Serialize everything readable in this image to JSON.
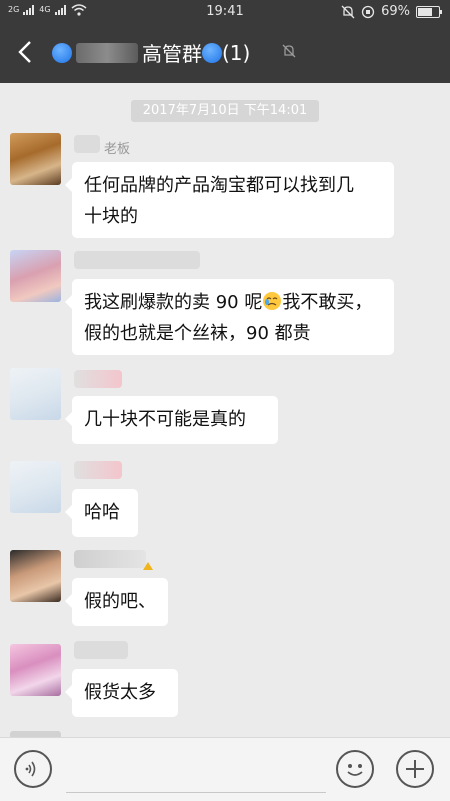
{
  "status_bar": {
    "signal_1": "2G",
    "signal_2": "4G",
    "time": "19:41",
    "battery": "69%",
    "battery_fraction": 0.69
  },
  "header": {
    "title": "高管群",
    "count": "(1)"
  },
  "chat": {
    "timestamp": "2017年7月10日 下午14:01",
    "messages": [
      {
        "sender": "老板",
        "lines": [
          "任何品牌的产品淘宝都可以找到几",
          "十块的"
        ]
      },
      {
        "sender": "",
        "line1_before": "我这刷爆款的卖 90 呢",
        "line1_after": "我不敢买，",
        "line2": "假的也就是个丝袜，90 都贵"
      },
      {
        "sender": "",
        "text": "几十块不可能是真的"
      },
      {
        "sender": "",
        "text": "哈哈"
      },
      {
        "sender": "",
        "text": "假的吧、"
      },
      {
        "sender": "",
        "text": "假货太多"
      }
    ]
  },
  "input_bar": {
    "placeholder": ""
  },
  "icons": [
    "back-arrow-icon",
    "mute-bell-icon",
    "voice-icon",
    "emoji-icon",
    "plus-icon"
  ],
  "colors": {
    "topbar": "#3a3a3a",
    "chat_bg": "#ebebeb",
    "bubble": "#ffffff",
    "timestamp_bg": "#d6d6d6"
  }
}
